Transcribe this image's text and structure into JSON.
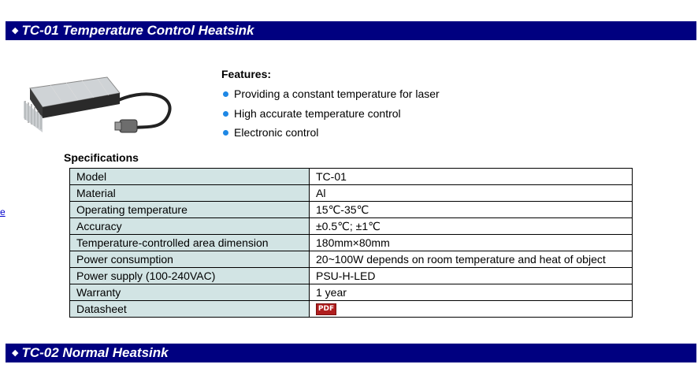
{
  "header_clip": {
    "brand": "",
    "text": ""
  },
  "section1": {
    "title": "TC-01 Temperature Control Heatsink"
  },
  "features": {
    "title": "Features:",
    "items": [
      "Providing a constant temperature for laser",
      "High accurate temperature control",
      "Electronic control"
    ]
  },
  "specifications": {
    "title": "Specifications",
    "rows": [
      {
        "label": "Model",
        "value": "TC-01"
      },
      {
        "label": "Material",
        "value": "Al"
      },
      {
        "label": "Operating temperature",
        "value": "15℃-35℃"
      },
      {
        "label": "Accuracy",
        "value": "±0.5℃; ±1℃"
      },
      {
        "label": "Temperature-controlled area dimension",
        "value": "180mm×80mm"
      },
      {
        "label": "Power consumption",
        "value": "20~100W depends on room temperature and heat of object"
      },
      {
        "label": "Power supply (100-240VAC)",
        "value": "PSU-H-LED"
      },
      {
        "label": "Warranty",
        "value": "1 year"
      },
      {
        "label": "Datasheet",
        "value": "PDF"
      }
    ]
  },
  "section2": {
    "title": "TC-02 Normal Heatsink"
  },
  "left_mark": "e",
  "icons": {
    "section_marker": "diamond-icon",
    "feature_bullet": "dot-icon",
    "datasheet": "pdf-icon",
    "product": "heatsink-image"
  },
  "colors": {
    "section_bar": "#000080",
    "spec_label_bg": "#d2e4e4",
    "bullet": "#1e88e5",
    "pdf": "#b01e1e"
  }
}
